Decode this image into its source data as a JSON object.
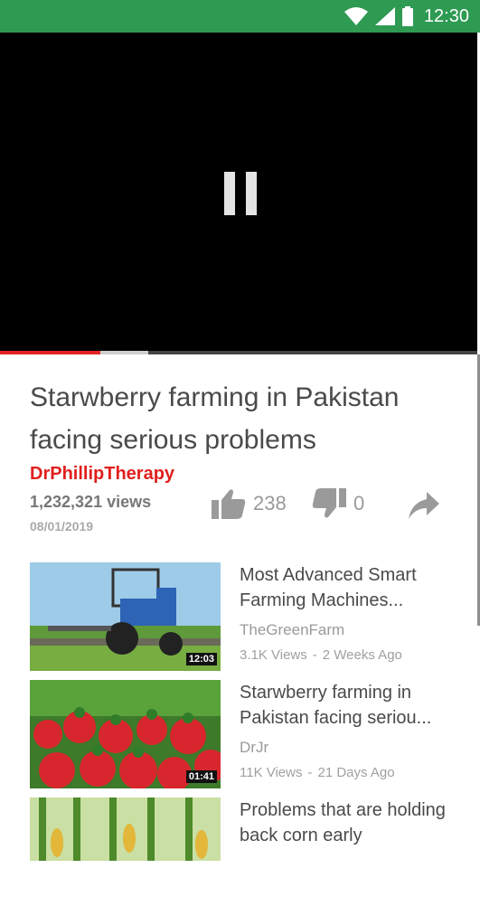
{
  "status_bar": {
    "time": "12:30",
    "icons": [
      "wifi-icon",
      "signal-icon",
      "battery-icon"
    ]
  },
  "player": {
    "state": "paused",
    "progress_played": 0.21,
    "progress_buffered": 0.31
  },
  "video": {
    "title": "Starwberry farming in Pakistan facing serious problems",
    "channel": "DrPhillipTherapy",
    "views": "1,232,321 views",
    "date": "08/01/2019",
    "likes": "238",
    "dislikes": "0"
  },
  "colors": {
    "status_bar": "#2e9a52",
    "channel": "#e0201e",
    "progress": "#e52222"
  },
  "related": [
    {
      "title": "Most Advanced Smart Farming Machines...",
      "channel": "TheGreenFarm",
      "views": "3.1K Views",
      "age": "2 Weeks Ago",
      "duration": "12:03"
    },
    {
      "title": "Starwberry farming in Pakistan facing seriou...",
      "channel": "DrJr",
      "views": "11K Views",
      "age": "21 Days Ago",
      "duration": "01:41"
    },
    {
      "title": "Problems that are holding back corn early",
      "channel": "",
      "views": "",
      "age": "",
      "duration": ""
    }
  ]
}
